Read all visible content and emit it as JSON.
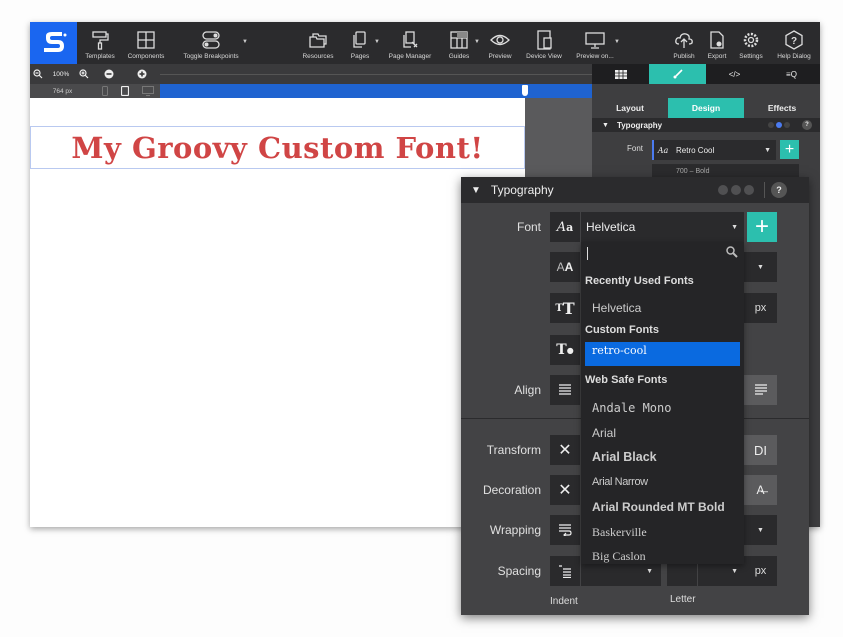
{
  "toolbar": {
    "items": [
      {
        "label": "Templates",
        "icon": "paint-roller-icon"
      },
      {
        "label": "Components",
        "icon": "components-icon"
      },
      {
        "label": "Toggle Breakpoints",
        "icon": "toggle-icon"
      },
      {
        "label": "Resources",
        "icon": "folders-icon"
      },
      {
        "label": "Pages",
        "icon": "pages-icon"
      },
      {
        "label": "Page Manager",
        "icon": "page-manager-icon"
      },
      {
        "label": "Guides",
        "icon": "guides-icon"
      },
      {
        "label": "Preview",
        "icon": "eye-icon"
      },
      {
        "label": "Device View",
        "icon": "device-view-icon"
      },
      {
        "label": "Preview on...",
        "icon": "monitor-icon"
      },
      {
        "label": "Publish",
        "icon": "cloud-upload-icon"
      },
      {
        "label": "Export",
        "icon": "export-icon"
      },
      {
        "label": "Settings",
        "icon": "gear-icon"
      },
      {
        "label": "Help Dialog",
        "icon": "help-icon"
      }
    ]
  },
  "zoom": {
    "level": "100%",
    "width": "764 px"
  },
  "canvas": {
    "heading": "My Groovy Custom Font!",
    "heading_color": "#d04545"
  },
  "right_panel": {
    "sub_tabs": [
      "Layout",
      "Design",
      "Effects"
    ],
    "active_sub_tab": "Design",
    "section_title": "Typography",
    "font_label": "Font",
    "font_value": "Retro Cool",
    "weight_value": "700 – Bold"
  },
  "typography": {
    "title": "Typography",
    "help": "?",
    "labels": {
      "font": "Font",
      "align": "Align",
      "transform": "Transform",
      "decoration": "Decoration",
      "wrapping": "Wrapping",
      "spacing": "Spacing",
      "indent": "Indent",
      "letter": "Letter"
    },
    "font_value": "Helvetica",
    "size_unit": "px",
    "spacing_unit": "px",
    "transform_extra": "DI"
  },
  "dropdown": {
    "search_value": "",
    "groups": {
      "recent": "Recently Used Fonts",
      "custom": "Custom Fonts",
      "websafe": "Web Safe Fonts"
    },
    "recent_items": [
      "Helvetica"
    ],
    "custom_items": [
      "retro-cool"
    ],
    "selected": "retro-cool",
    "websafe_items": [
      "Andale Mono",
      "Arial",
      "Arial Black",
      "Arial Narrow",
      "Arial Rounded MT Bold",
      "Baskerville",
      "Big Caslon"
    ]
  },
  "colors": {
    "accent": "#2cbfae",
    "brand": "#1a66f0",
    "selection": "#0a6ae0"
  }
}
